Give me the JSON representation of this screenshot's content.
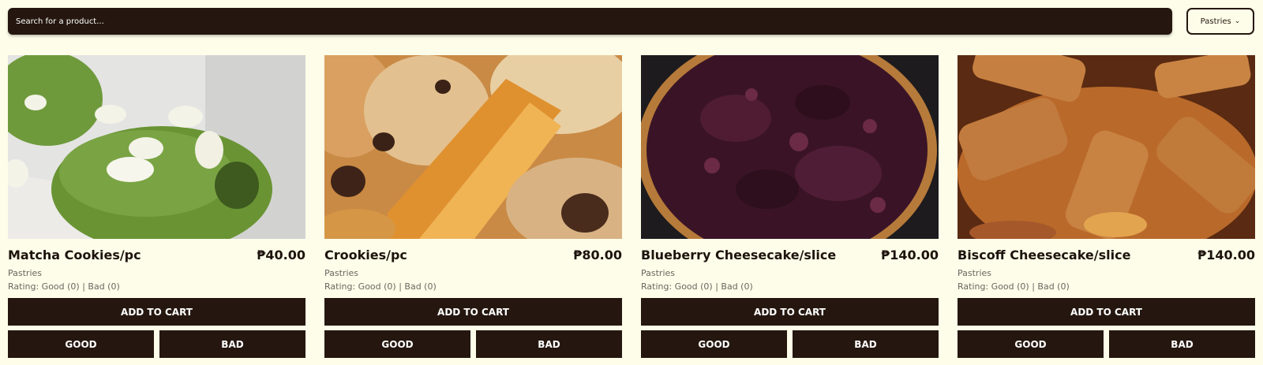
{
  "search": {
    "placeholder": "Search for a product..."
  },
  "filter": {
    "selected": "Pastries"
  },
  "products": [
    {
      "name": "Matcha Cookies/pc",
      "price": "₱40.00",
      "category": "Pastries",
      "rating": "Rating: Good (0) | Bad (0)",
      "image": "matcha-cookies-photo"
    },
    {
      "name": "Crookies/pc",
      "price": "₱80.00",
      "category": "Pastries",
      "rating": "Rating: Good (0) | Bad (0)",
      "image": "crookies-photo"
    },
    {
      "name": "Blueberry Cheesecake/slice",
      "price": "₱140.00",
      "category": "Pastries",
      "rating": "Rating: Good (0) | Bad (0)",
      "image": "blueberry-cheesecake-photo"
    },
    {
      "name": "Biscoff Cheesecake/slice",
      "price": "₱140.00",
      "category": "Pastries",
      "rating": "Rating: Good (0) | Bad (0)",
      "image": "biscoff-cheesecake-photo"
    }
  ],
  "buttons": {
    "add_to_cart": "ADD TO CART",
    "good": "GOOD",
    "bad": "BAD"
  },
  "colors": {
    "background": "#fdfde9",
    "primary": "#25170f",
    "muted_text": "#6b6660"
  }
}
